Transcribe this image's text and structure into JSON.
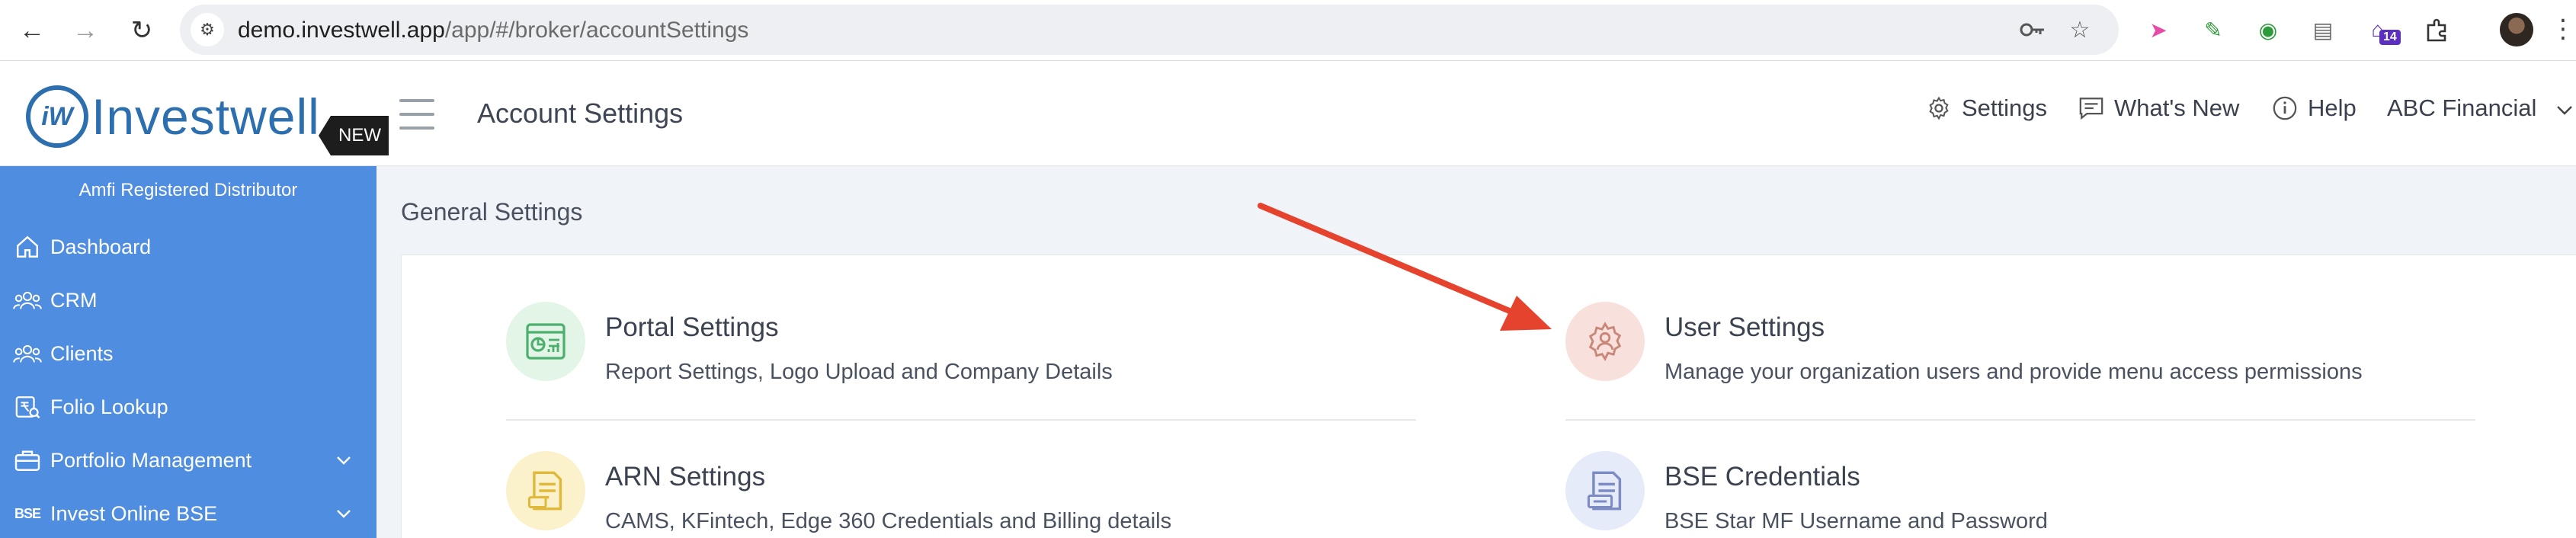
{
  "browser": {
    "url_host": "demo.investwell.app",
    "url_path": "/app/#/broker/accountSettings",
    "extension_badge": "14"
  },
  "header": {
    "logo_text": "Investwell",
    "logo_mark": "iW",
    "page_title": "Account Settings",
    "settings_label": "Settings",
    "whats_new_label": "What's New",
    "help_label": "Help",
    "account_label": "ABC Financial"
  },
  "sidebar": {
    "distributor_label": "Amfi Registered Distributor",
    "new_badge": "NEW",
    "items": [
      {
        "label": "Dashboard",
        "icon": "home-icon"
      },
      {
        "label": "CRM",
        "icon": "users-group-icon"
      },
      {
        "label": "Clients",
        "icon": "clients-icon"
      },
      {
        "label": "Folio Lookup",
        "icon": "rupee-search-icon"
      },
      {
        "label": "Portfolio Management",
        "icon": "briefcase-icon"
      },
      {
        "label": "Invest Online BSE",
        "icon": "bse-icon"
      }
    ]
  },
  "main": {
    "section_title": "General Settings",
    "settings": [
      {
        "title": "Portal Settings",
        "desc": "Report Settings, Logo Upload and Company Details",
        "color": "#e3f5e6",
        "icon": "report-icon"
      },
      {
        "title": "User Settings",
        "desc": "Manage your organization users and provide menu access permissions",
        "color": "#f8e1dc",
        "icon": "user-gear-icon"
      },
      {
        "title": "ARN Settings",
        "desc": "CAMS, KFintech, Edge 360 Credentials and Billing details",
        "color": "#fbf2cc",
        "icon": "document-icon"
      },
      {
        "title": "BSE Credentials",
        "desc": "BSE Star MF Username and Password",
        "color": "#e6ebf9",
        "icon": "credentials-icon"
      }
    ]
  },
  "colors": {
    "brand": "#2d6fae",
    "sidebar": "#4f8de1",
    "annotation_arrow": "#e5432d"
  }
}
